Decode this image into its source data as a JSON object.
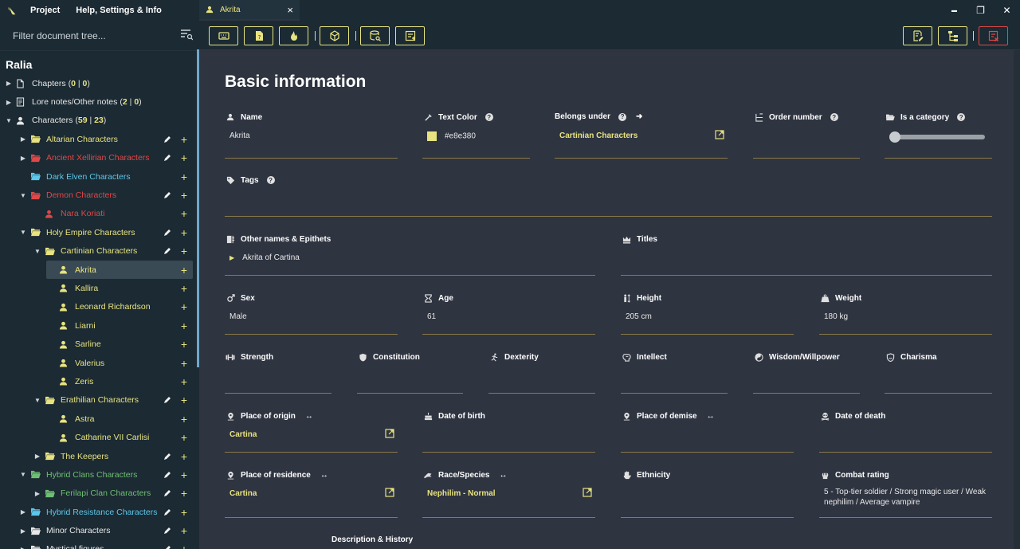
{
  "menubar": {
    "project": "Project",
    "help": "Help, Settings & Info"
  },
  "filter": {
    "placeholder": "Filter document tree..."
  },
  "project_name": "Ralia",
  "tree": [
    {
      "label": "Chapters",
      "counts": [
        "0",
        "0"
      ],
      "level": 0,
      "arrow": "▶",
      "icon": "document-icon",
      "color": "w",
      "pen": false,
      "plus": false
    },
    {
      "label": "Lore notes/Other notes",
      "counts": [
        "2",
        "0"
      ],
      "level": 0,
      "arrow": "▶",
      "icon": "notes-icon",
      "color": "w",
      "pen": false,
      "plus": false
    },
    {
      "label": "Characters",
      "counts": [
        "59",
        "23"
      ],
      "level": 0,
      "arrow": "▼",
      "icon": "person-icon",
      "color": "w",
      "pen": false,
      "plus": false
    },
    {
      "label": "Altarian Characters",
      "level": 1,
      "arrow": "▶",
      "icon": "folder-icon",
      "color": "y",
      "pen": true,
      "plus": true
    },
    {
      "label": "Ancient Xellirian Characters",
      "level": 1,
      "arrow": "▶",
      "icon": "folder-icon",
      "color": "r",
      "pen": true,
      "plus": true
    },
    {
      "label": "Dark Elven Characters",
      "level": 1,
      "arrow": "",
      "icon": "folder-icon",
      "color": "b",
      "pen": false,
      "plus": true
    },
    {
      "label": "Demon Characters",
      "level": 1,
      "arrow": "▼",
      "icon": "folder-icon",
      "color": "r",
      "pen": true,
      "plus": true
    },
    {
      "label": "Nara Koriati",
      "level": 2,
      "arrow": "",
      "icon": "person-icon",
      "color": "r",
      "pen": false,
      "plus": true
    },
    {
      "label": "Holy Empire Characters",
      "level": 1,
      "arrow": "▼",
      "icon": "folder-icon",
      "color": "y",
      "pen": true,
      "plus": true
    },
    {
      "label": "Cartinian Characters",
      "level": 2,
      "arrow": "▼",
      "icon": "folder-icon",
      "color": "y",
      "pen": true,
      "plus": true
    },
    {
      "label": "Akrita",
      "level": 3,
      "arrow": "",
      "icon": "person-icon",
      "color": "y",
      "pen": false,
      "plus": true,
      "selected": true
    },
    {
      "label": "Kallira",
      "level": 3,
      "arrow": "",
      "icon": "person-icon",
      "color": "y",
      "pen": false,
      "plus": true
    },
    {
      "label": "Leonard Richardson",
      "level": 3,
      "arrow": "",
      "icon": "person-icon",
      "color": "y",
      "pen": false,
      "plus": true
    },
    {
      "label": "Liarni",
      "level": 3,
      "arrow": "",
      "icon": "person-icon",
      "color": "y",
      "pen": false,
      "plus": true
    },
    {
      "label": "Sarline",
      "level": 3,
      "arrow": "",
      "icon": "person-icon",
      "color": "y",
      "pen": false,
      "plus": true
    },
    {
      "label": "Valerius",
      "level": 3,
      "arrow": "",
      "icon": "person-icon",
      "color": "y",
      "pen": false,
      "plus": true
    },
    {
      "label": "Zeris",
      "level": 3,
      "arrow": "",
      "icon": "person-icon",
      "color": "y",
      "pen": false,
      "plus": true
    },
    {
      "label": "Erathilian Characters",
      "level": 2,
      "arrow": "▼",
      "icon": "folder-icon",
      "color": "y",
      "pen": true,
      "plus": true
    },
    {
      "label": "Astra",
      "level": 3,
      "arrow": "",
      "icon": "person-icon",
      "color": "y",
      "pen": false,
      "plus": true
    },
    {
      "label": "Catharine VII Carlisi",
      "level": 3,
      "arrow": "",
      "icon": "person-icon",
      "color": "y",
      "pen": false,
      "plus": true
    },
    {
      "label": "The Keepers",
      "level": 2,
      "arrow": "▶",
      "icon": "folder-icon",
      "color": "y",
      "pen": true,
      "plus": true
    },
    {
      "label": "Hybrid Clans Characters",
      "level": 1,
      "arrow": "▼",
      "icon": "folder-icon",
      "color": "g",
      "pen": true,
      "plus": true
    },
    {
      "label": "Ferilapi Clan Characters",
      "level": 2,
      "arrow": "▶",
      "icon": "folder-icon",
      "color": "g",
      "pen": true,
      "plus": true
    },
    {
      "label": "Hybrid Resistance Characters",
      "level": 1,
      "arrow": "▶",
      "icon": "folder-icon",
      "color": "b",
      "pen": true,
      "plus": true
    },
    {
      "label": "Minor Characters",
      "level": 1,
      "arrow": "▶",
      "icon": "folder-icon",
      "color": "w",
      "pen": true,
      "plus": true
    },
    {
      "label": "Mystical figures",
      "level": 1,
      "arrow": "▶",
      "icon": "folder-icon",
      "color": "w",
      "pen": true,
      "plus": true
    }
  ],
  "tab": {
    "label": "Akrita",
    "close": "×"
  },
  "window": {
    "minimize": "▬",
    "restore": "❐",
    "close": "✕"
  },
  "colors": {
    "accent": "#e8e380",
    "danger": "#e04848",
    "bg": "#2e3440",
    "sidebar": "#1b2a33"
  },
  "main": {
    "title": "Basic information",
    "fields": {
      "name": {
        "label": "Name",
        "value": "Akrita"
      },
      "text_color": {
        "label": "Text Color",
        "value": "#e8e380"
      },
      "belongs_under": {
        "label": "Belongs under",
        "value": "Cartinian Characters"
      },
      "order_number": {
        "label": "Order number",
        "value": ""
      },
      "is_category": {
        "label": "Is a category",
        "value": 0
      },
      "tags": {
        "label": "Tags",
        "value": ""
      },
      "other_names": {
        "label": "Other names & Epithets",
        "value": "Akrita of Cartina"
      },
      "titles": {
        "label": "Titles",
        "value": ""
      },
      "sex": {
        "label": "Sex",
        "value": "Male"
      },
      "age": {
        "label": "Age",
        "value": "61"
      },
      "height": {
        "label": "Height",
        "value": "205 cm"
      },
      "weight": {
        "label": "Weight",
        "value": "180 kg"
      },
      "strength": {
        "label": "Strength",
        "value": ""
      },
      "constitution": {
        "label": "Constitution",
        "value": ""
      },
      "dexterity": {
        "label": "Dexterity",
        "value": ""
      },
      "intellect": {
        "label": "Intellect",
        "value": ""
      },
      "wisdom": {
        "label": "Wisdom/Willpower",
        "value": ""
      },
      "charisma": {
        "label": "Charisma",
        "value": ""
      },
      "place_of_origin": {
        "label": "Place of origin",
        "value": "Cartina"
      },
      "date_of_birth": {
        "label": "Date of birth",
        "value": ""
      },
      "place_of_demise": {
        "label": "Place of demise",
        "value": ""
      },
      "date_of_death": {
        "label": "Date of death",
        "value": ""
      },
      "place_of_residence": {
        "label": "Place of residence",
        "value": "Cartina"
      },
      "race": {
        "label": "Race/Species",
        "value": "Nephilim - Normal"
      },
      "ethnicity": {
        "label": "Ethnicity",
        "value": ""
      },
      "combat_rating": {
        "label": "Combat rating",
        "value": "5 - Top-tier soldier / Strong magic user / Weak nephilim / Average vampire"
      }
    },
    "description_label": "Description & History"
  }
}
